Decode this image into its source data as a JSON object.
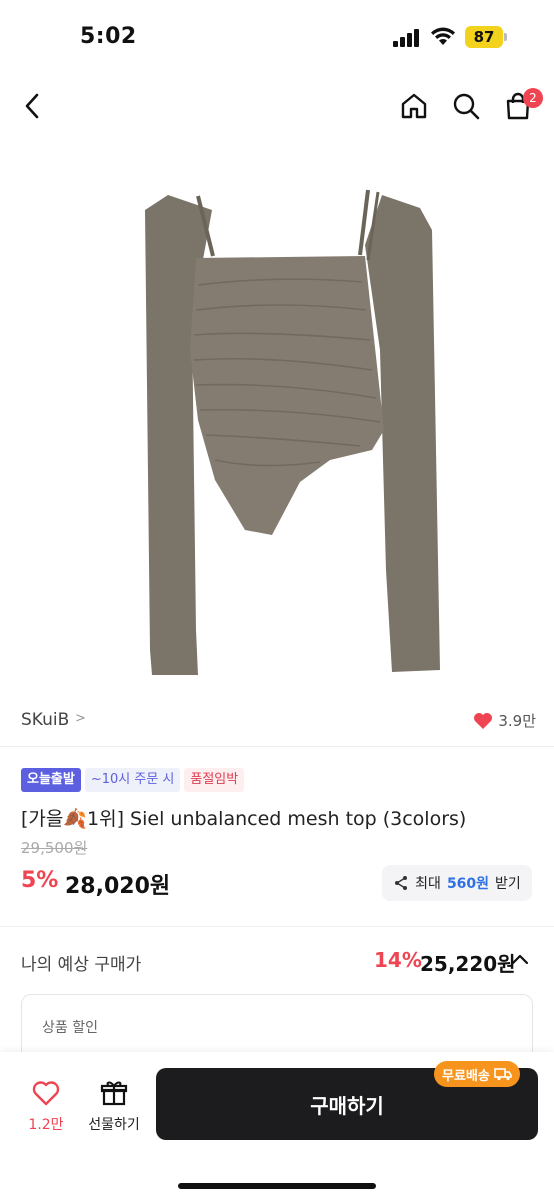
{
  "status_bar": {
    "time": "5:02",
    "battery_level": "87"
  },
  "nav": {
    "cart_count": "2"
  },
  "product": {
    "brand": "SKuiB",
    "brand_chevron": ">",
    "likes": "3.9만",
    "badges": {
      "today": "오늘출발",
      "time": "~10시 주문 시",
      "soldout": "품절임박"
    },
    "title": "[가을🍂1위] Siel unbalanced mesh top (3colors)",
    "original_price": "29,500원",
    "discount_rate": "5%",
    "sale_price": "28,020원",
    "coupon": {
      "prefix": "최대",
      "amount": "560원",
      "suffix": "받기"
    }
  },
  "expected": {
    "label": "나의 예상 구매가",
    "rate": "14%",
    "price": "25,220원",
    "discount_section_title": "상품 할인"
  },
  "bottom_bar": {
    "wish_count": "1.2만",
    "gift_label": "선물하기",
    "buy_label": "구매하기",
    "shipping_badge": "무료배송"
  },
  "colors": {
    "accent_red": "#ef4452",
    "today_badge": "#5b5fe0",
    "coupon_blue": "#2f70e6",
    "shipping_orange": "#f7941d",
    "product_fabric": "#7b7468"
  }
}
